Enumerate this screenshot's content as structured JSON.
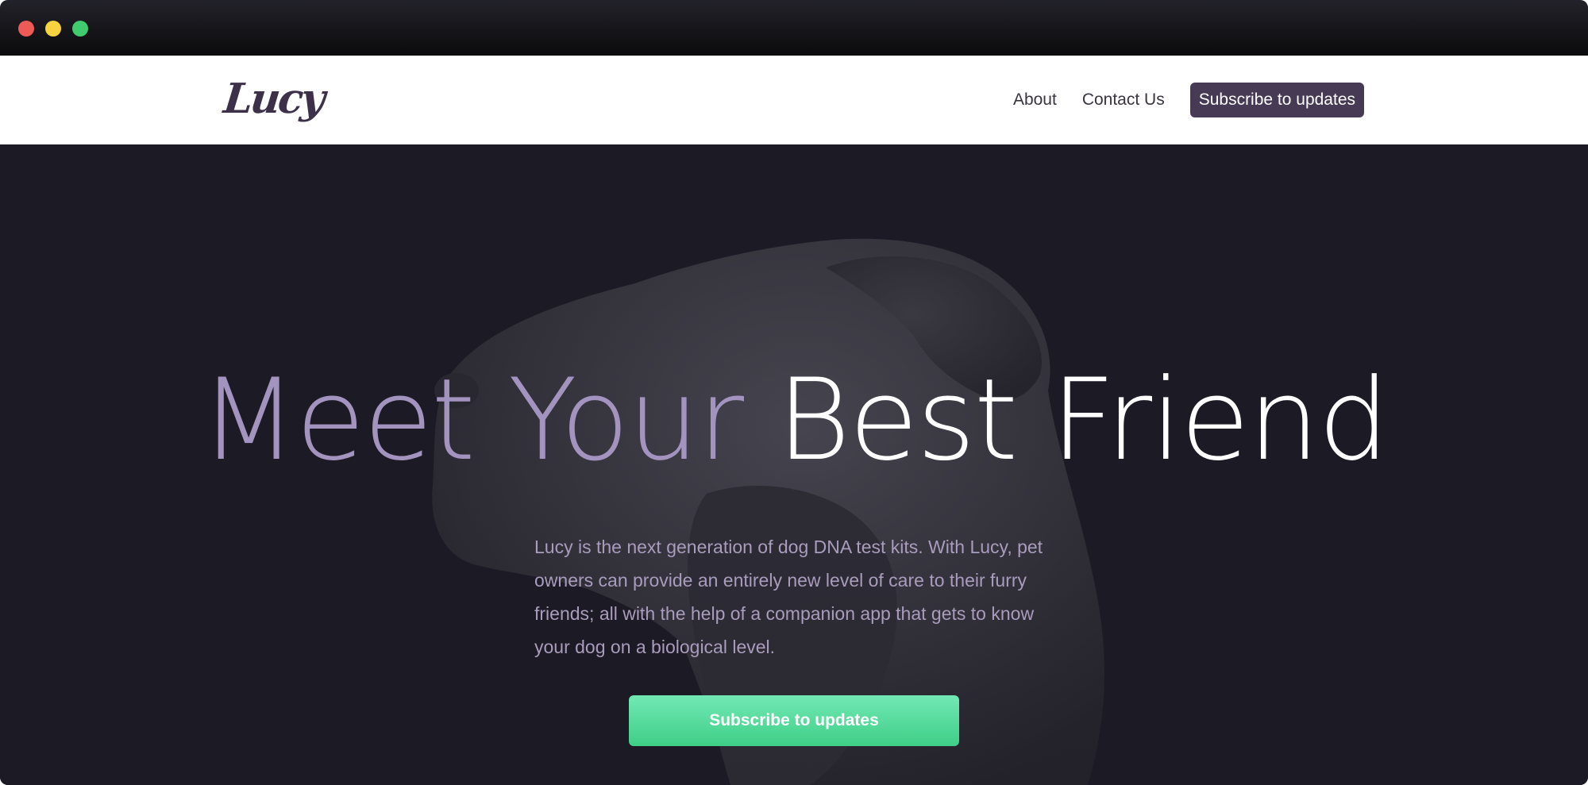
{
  "brand": {
    "name": "Lucy"
  },
  "nav": {
    "about": "About",
    "contact": "Contact Us",
    "cta": "Subscribe to updates"
  },
  "hero": {
    "headline_part1": "Meet Your",
    "headline_part2": "Best Friend",
    "body": "Lucy is the next generation of dog DNA test kits. With Lucy, pet owners can provide an entirely new level of care to their furry friends; all with the help of a companion app that gets to know your dog on a biological level.",
    "cta": "Subscribe to updates",
    "image": "dog-silhouette"
  },
  "colors": {
    "brand_purple": "#463a55",
    "hero_bg": "#1c1a24",
    "cta_green": "#4ad894",
    "headline_muted": "#a393bf"
  }
}
